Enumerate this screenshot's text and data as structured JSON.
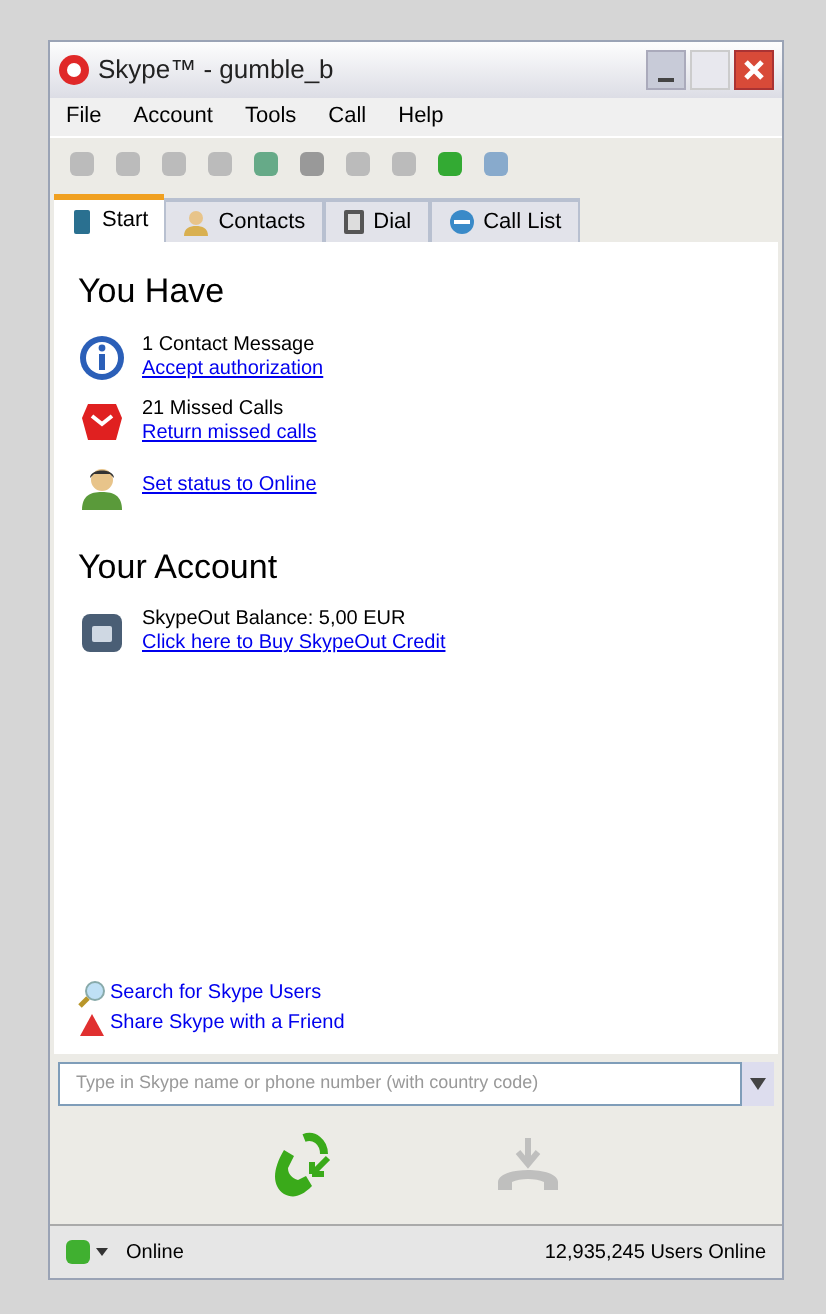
{
  "window": {
    "title": "Skype™ - gumble_b"
  },
  "menu": [
    "File",
    "Account",
    "Tools",
    "Call",
    "Help"
  ],
  "tabs": [
    {
      "label": "Start",
      "selected": true
    },
    {
      "label": "Contacts",
      "selected": false
    },
    {
      "label": "Dial",
      "selected": false
    },
    {
      "label": "Call List",
      "selected": false
    }
  ],
  "sections": [
    {
      "heading": "You Have",
      "items": [
        {
          "kind": "info",
          "title": "1 Contact Message",
          "link": "Accept authorization"
        },
        {
          "kind": "missed",
          "title": "21 Missed Calls",
          "link": "Return missed calls"
        },
        {
          "kind": "person",
          "link": "Set status to Online"
        }
      ]
    },
    {
      "heading": "Your Account",
      "items": [
        {
          "kind": "account",
          "title": "SkypeOut Balance: 5,00 EUR",
          "link": "Click here to Buy SkypeOut Credit"
        }
      ]
    }
  ],
  "footer_links": [
    {
      "kind": "search",
      "label": "Search for Skype Users"
    },
    {
      "kind": "share",
      "label": "Share Skype with a Friend"
    }
  ],
  "dial_field": {
    "placeholder": "Type in Skype name or phone number (with country code)"
  },
  "call_buttons": [
    {
      "kind": "call",
      "disabled": false
    },
    {
      "kind": "hangup",
      "disabled": true
    }
  ],
  "status_bar": {
    "status": "Online",
    "users_online": "12,935,245 Users Online"
  }
}
